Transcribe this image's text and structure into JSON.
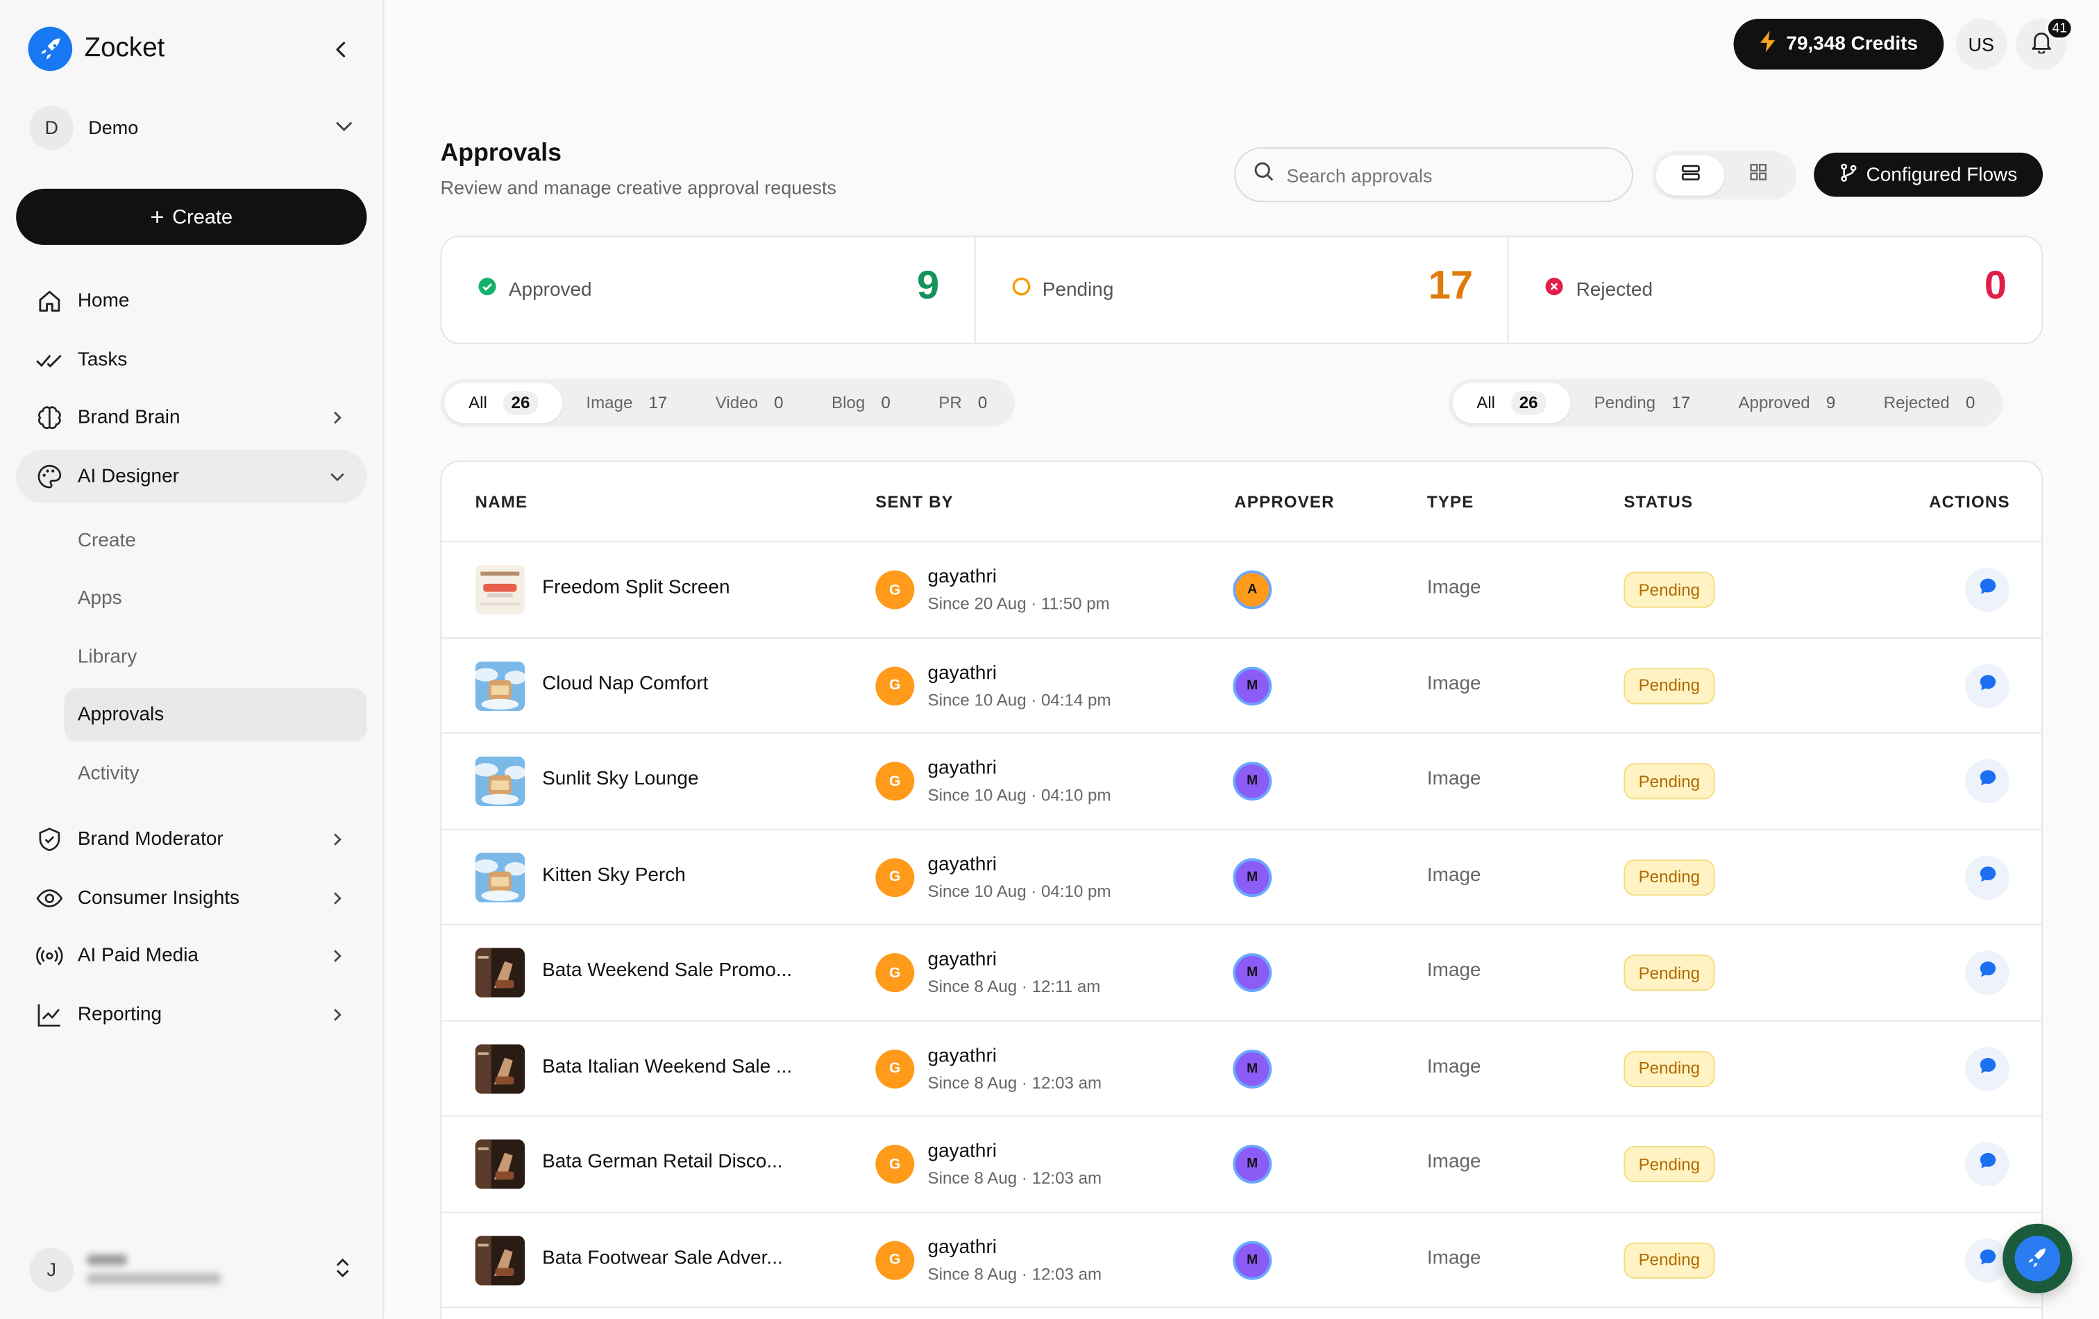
{
  "brand": {
    "name": "Zocket"
  },
  "workspace": {
    "initial": "D",
    "name": "Demo"
  },
  "sidebar": {
    "create_label": "Create",
    "items": [
      {
        "label": "Home",
        "icon": "home-icon"
      },
      {
        "label": "Tasks",
        "icon": "check-double-icon"
      },
      {
        "label": "Brand Brain",
        "icon": "brain-icon"
      },
      {
        "label": "AI Designer",
        "icon": "palette-icon",
        "expanded": true
      },
      {
        "label": "Brand Moderator",
        "icon": "shield-icon"
      },
      {
        "label": "Consumer Insights",
        "icon": "eye-icon"
      },
      {
        "label": "AI Paid Media",
        "icon": "broadcast-icon"
      },
      {
        "label": "Reporting",
        "icon": "chart-line-icon"
      }
    ],
    "sub_items": [
      {
        "label": "Create"
      },
      {
        "label": "Apps"
      },
      {
        "label": "Library"
      },
      {
        "label": "Approvals",
        "active": true
      },
      {
        "label": "Activity"
      }
    ],
    "user": {
      "initial": "J"
    }
  },
  "header": {
    "credits": "79,348 Credits",
    "locale": "US",
    "notifications": "41"
  },
  "page": {
    "title": "Approvals",
    "subtitle": "Review and manage creative approval requests",
    "search_placeholder": "Search approvals",
    "configured_flows": "Configured Flows"
  },
  "summary": [
    {
      "label": "Approved",
      "value": "9",
      "color": "#14935a"
    },
    {
      "label": "Pending",
      "value": "17",
      "color": "#e07a0a"
    },
    {
      "label": "Rejected",
      "value": "0",
      "color": "#e11d48"
    }
  ],
  "type_filters": [
    {
      "label": "All",
      "count": "26",
      "on": true
    },
    {
      "label": "Image",
      "count": "17"
    },
    {
      "label": "Video",
      "count": "0"
    },
    {
      "label": "Blog",
      "count": "0"
    },
    {
      "label": "PR",
      "count": "0"
    }
  ],
  "status_filters": [
    {
      "label": "All",
      "count": "26",
      "on": true
    },
    {
      "label": "Pending",
      "count": "17"
    },
    {
      "label": "Approved",
      "count": "9"
    },
    {
      "label": "Rejected",
      "count": "0"
    }
  ],
  "table": {
    "headers": [
      "NAME",
      "SENT BY",
      "APPROVER",
      "TYPE",
      "STATUS",
      "ACTIONS"
    ],
    "rows": [
      {
        "name": "Freedom Split Screen",
        "sender": "gayathri",
        "sender_initial": "G",
        "date": "Since 20 Aug · 11:50 pm",
        "approver": "A",
        "approver_color": "#ff9a1a",
        "type": "Image",
        "status": "Pending",
        "thumb": "light"
      },
      {
        "name": "Cloud Nap Comfort",
        "sender": "gayathri",
        "sender_initial": "G",
        "date": "Since 10 Aug · 04:14 pm",
        "approver": "M",
        "approver_color": "#8b5cf6",
        "type": "Image",
        "status": "Pending",
        "thumb": "sky"
      },
      {
        "name": "Sunlit Sky Lounge",
        "sender": "gayathri",
        "sender_initial": "G",
        "date": "Since 10 Aug · 04:10 pm",
        "approver": "M",
        "approver_color": "#8b5cf6",
        "type": "Image",
        "status": "Pending",
        "thumb": "sky"
      },
      {
        "name": "Kitten Sky Perch",
        "sender": "gayathri",
        "sender_initial": "G",
        "date": "Since 10 Aug · 04:10 pm",
        "approver": "M",
        "approver_color": "#8b5cf6",
        "type": "Image",
        "status": "Pending",
        "thumb": "sky"
      },
      {
        "name": "Bata Weekend Sale Promo...",
        "sender": "gayathri",
        "sender_initial": "G",
        "date": "Since 8 Aug · 12:11 am",
        "approver": "M",
        "approver_color": "#8b5cf6",
        "type": "Image",
        "status": "Pending",
        "thumb": "dark"
      },
      {
        "name": "Bata Italian Weekend Sale ...",
        "sender": "gayathri",
        "sender_initial": "G",
        "date": "Since 8 Aug · 12:03 am",
        "approver": "M",
        "approver_color": "#8b5cf6",
        "type": "Image",
        "status": "Pending",
        "thumb": "dark"
      },
      {
        "name": "Bata German Retail Disco...",
        "sender": "gayathri",
        "sender_initial": "G",
        "date": "Since 8 Aug · 12:03 am",
        "approver": "M",
        "approver_color": "#8b5cf6",
        "type": "Image",
        "status": "Pending",
        "thumb": "dark"
      },
      {
        "name": "Bata Footwear Sale Adver...",
        "sender": "gayathri",
        "sender_initial": "G",
        "date": "Since 8 Aug · 12:03 am",
        "approver": "M",
        "approver_color": "#8b5cf6",
        "type": "Image",
        "status": "Pending",
        "thumb": "dark"
      }
    ]
  }
}
